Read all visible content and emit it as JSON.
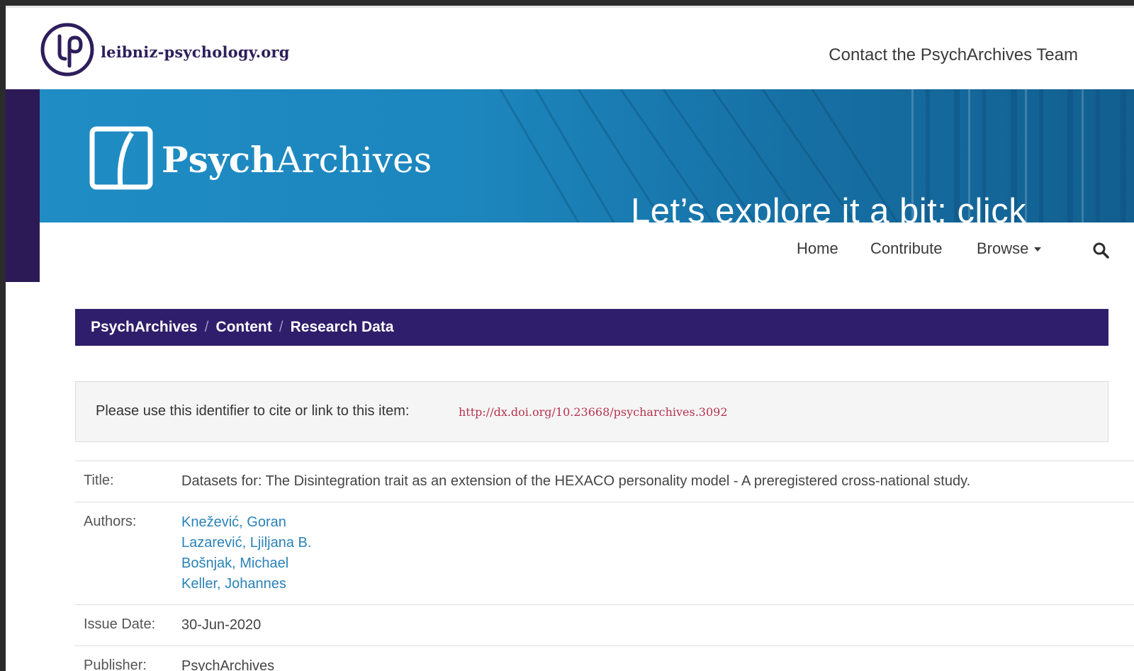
{
  "header": {
    "logo_text": "leibniz-psychology.org",
    "contact_link": "Contact the PsychArchives Team"
  },
  "banner": {
    "brand_bold": "Psych",
    "brand_light": "Archives",
    "overlay_text": "Let’s explore it a bit: click"
  },
  "nav": {
    "home": "Home",
    "contribute": "Contribute",
    "browse": "Browse"
  },
  "breadcrumb": {
    "items": [
      "PsychArchives",
      "Content",
      "Research Data"
    ],
    "separator": "/"
  },
  "citation": {
    "label": "Please use this identifier to cite or link to this item:",
    "doi": "http://dx.doi.org/10.23668/psycharchives.3092"
  },
  "metadata": {
    "title_key": "Title:",
    "title_value": "Datasets for: The Disintegration trait as an extension of the HEXACO personality model - A preregistered cross-national study.",
    "authors_key": "Authors:",
    "authors": [
      "Knežević, Goran",
      "Lazarević, Ljiljana B.",
      "Bošnjak, Michael",
      "Keller, Johannes"
    ],
    "issue_date_key": "Issue Date:",
    "issue_date_value": "30-Jun-2020",
    "publisher_key": "Publisher:",
    "publisher_value": "PsychArchives"
  },
  "colors": {
    "brand_purple": "#2e1e6b",
    "banner_blue": "#1f8cc4",
    "link_blue": "#2a82b8",
    "doi_red": "#b6334e"
  }
}
